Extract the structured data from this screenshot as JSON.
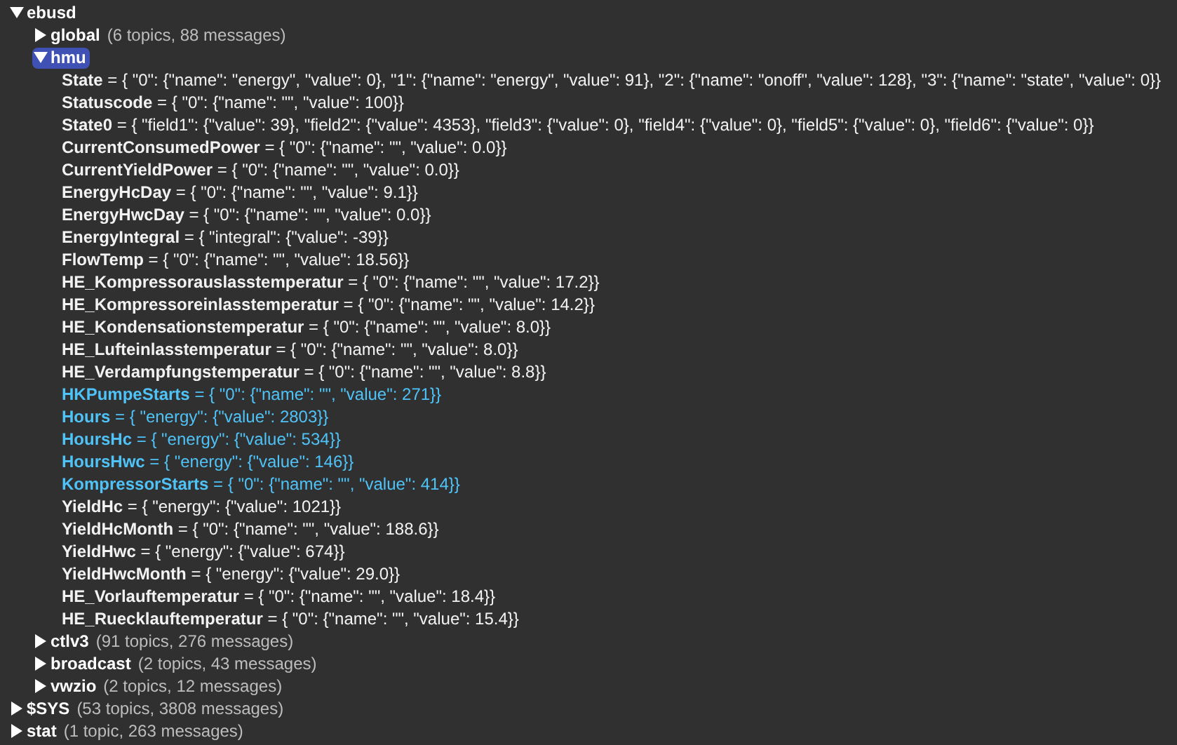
{
  "tree": [
    {
      "name": "ebusd",
      "expanded": true,
      "selected": false,
      "children": [
        {
          "name": "global",
          "expanded": false,
          "selected": false,
          "summary": "(6 topics, 88 messages)"
        },
        {
          "name": "hmu",
          "expanded": true,
          "selected": true,
          "children": [
            {
              "name": "State",
              "value": "= { \"0\": {\"name\": \"energy\", \"value\": 0}, \"1\": {\"name\": \"energy\", \"value\": 91}, \"2\": {\"name\": \"onoff\", \"value\": 128}, \"3\": {\"name\": \"state\", \"value\": 0}}",
              "changed": false
            },
            {
              "name": "Statuscode",
              "value": "= { \"0\": {\"name\": \"\", \"value\": 100}}",
              "changed": false
            },
            {
              "name": "State0",
              "value": "= { \"field1\": {\"value\": 39}, \"field2\": {\"value\": 4353}, \"field3\": {\"value\": 0}, \"field4\": {\"value\": 0}, \"field5\": {\"value\": 0}, \"field6\": {\"value\": 0}}",
              "changed": false
            },
            {
              "name": "CurrentConsumedPower",
              "value": "= { \"0\": {\"name\": \"\", \"value\": 0.0}}",
              "changed": false
            },
            {
              "name": "CurrentYieldPower",
              "value": "= { \"0\": {\"name\": \"\", \"value\": 0.0}}",
              "changed": false
            },
            {
              "name": "EnergyHcDay",
              "value": "= { \"0\": {\"name\": \"\", \"value\": 9.1}}",
              "changed": false
            },
            {
              "name": "EnergyHwcDay",
              "value": "= { \"0\": {\"name\": \"\", \"value\": 0.0}}",
              "changed": false
            },
            {
              "name": "EnergyIntegral",
              "value": "= { \"integral\": {\"value\": -39}}",
              "changed": false
            },
            {
              "name": "FlowTemp",
              "value": "= { \"0\": {\"name\": \"\", \"value\": 18.56}}",
              "changed": false
            },
            {
              "name": "HE_Kompressorauslasstemperatur",
              "value": "= { \"0\": {\"name\": \"\", \"value\": 17.2}}",
              "changed": false
            },
            {
              "name": "HE_Kompressoreinlasstemperatur",
              "value": "= { \"0\": {\"name\": \"\", \"value\": 14.2}}",
              "changed": false
            },
            {
              "name": "HE_Kondensationstemperatur",
              "value": "= { \"0\": {\"name\": \"\", \"value\": 8.0}}",
              "changed": false
            },
            {
              "name": "HE_Lufteinlasstemperatur",
              "value": "= { \"0\": {\"name\": \"\", \"value\": 8.0}}",
              "changed": false
            },
            {
              "name": "HE_Verdampfungstemperatur",
              "value": "= { \"0\": {\"name\": \"\", \"value\": 8.8}}",
              "changed": false
            },
            {
              "name": "HKPumpeStarts",
              "value": "= { \"0\": {\"name\": \"\", \"value\": 271}}",
              "changed": true
            },
            {
              "name": "Hours",
              "value": "= { \"energy\": {\"value\": 2803}}",
              "changed": true
            },
            {
              "name": "HoursHc",
              "value": "= { \"energy\": {\"value\": 534}}",
              "changed": true
            },
            {
              "name": "HoursHwc",
              "value": "= { \"energy\": {\"value\": 146}}",
              "changed": true
            },
            {
              "name": "KompressorStarts",
              "value": "= { \"0\": {\"name\": \"\", \"value\": 414}}",
              "changed": true
            },
            {
              "name": "YieldHc",
              "value": "= { \"energy\": {\"value\": 1021}}",
              "changed": false
            },
            {
              "name": "YieldHcMonth",
              "value": "= { \"0\": {\"name\": \"\", \"value\": 188.6}}",
              "changed": false
            },
            {
              "name": "YieldHwc",
              "value": "= { \"energy\": {\"value\": 674}}",
              "changed": false
            },
            {
              "name": "YieldHwcMonth",
              "value": "= { \"energy\": {\"value\": 29.0}}",
              "changed": false
            },
            {
              "name": "HE_Vorlauftemperatur",
              "value": "= { \"0\": {\"name\": \"\", \"value\": 18.4}}",
              "changed": false
            },
            {
              "name": "HE_Ruecklauftemperatur",
              "value": "= { \"0\": {\"name\": \"\", \"value\": 15.4}}",
              "changed": false
            }
          ]
        },
        {
          "name": "ctlv3",
          "expanded": false,
          "selected": false,
          "summary": "(91 topics, 276 messages)"
        },
        {
          "name": "broadcast",
          "expanded": false,
          "selected": false,
          "summary": "(2 topics, 43 messages)"
        },
        {
          "name": "vwzio",
          "expanded": false,
          "selected": false,
          "summary": "(2 topics, 12 messages)"
        }
      ]
    },
    {
      "name": "$SYS",
      "expanded": false,
      "selected": false,
      "summary": "(53 topics, 3808 messages)"
    },
    {
      "name": "stat",
      "expanded": false,
      "selected": false,
      "summary": "(1 topic, 263 messages)"
    }
  ]
}
